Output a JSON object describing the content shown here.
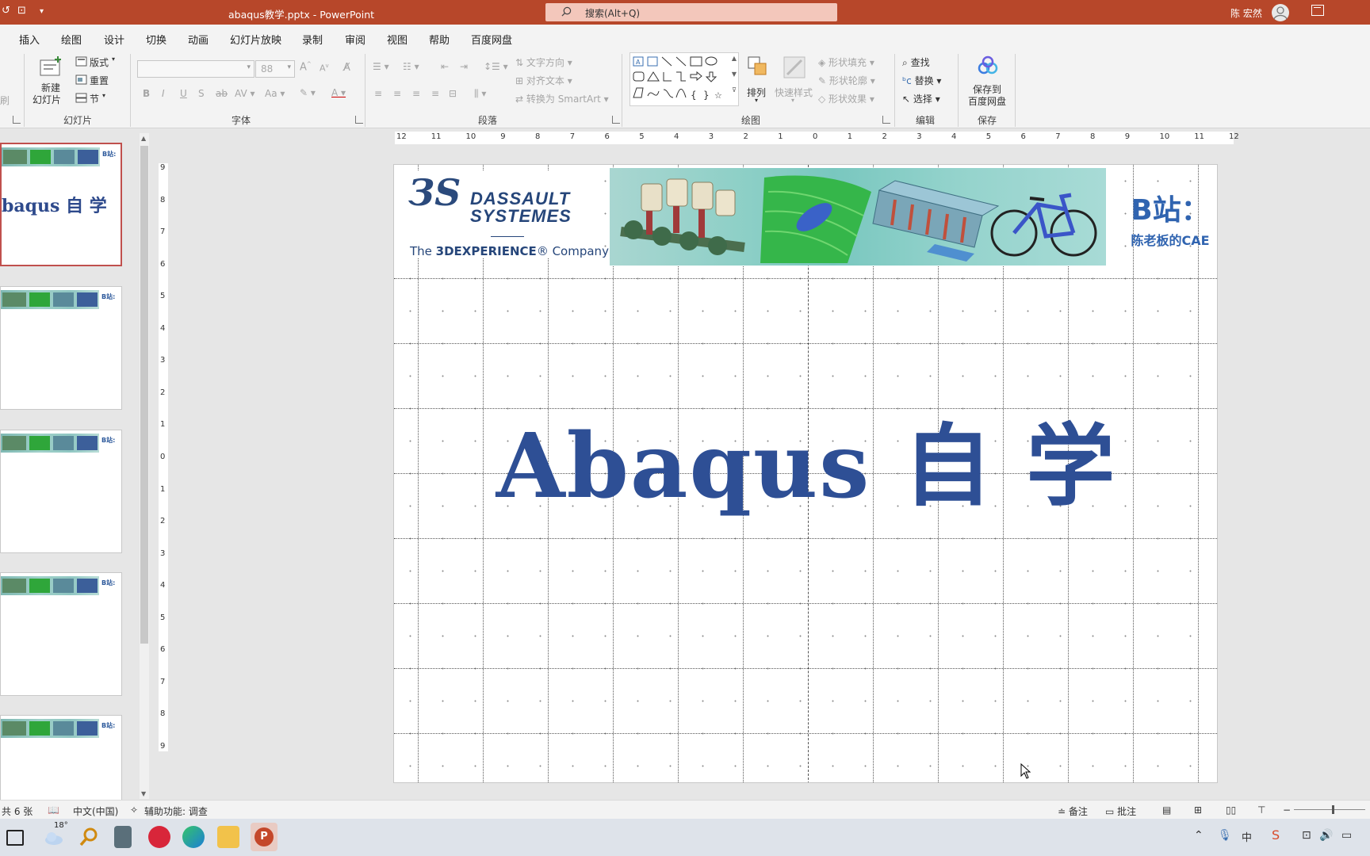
{
  "titlebar": {
    "title": "abaqus教学.pptx  -  PowerPoint",
    "search_placeholder": "搜索(Alt+Q)",
    "user": "陈 宏然"
  },
  "menu": {
    "tabs": [
      "插入",
      "绘图",
      "设计",
      "切换",
      "动画",
      "幻灯片放映",
      "录制",
      "审阅",
      "视图",
      "帮助",
      "百度网盘"
    ]
  },
  "ribbon": {
    "slides": {
      "new_slide": "新建\n幻灯片",
      "new_slide_l1": "新建",
      "new_slide_l2": "幻灯片",
      "layout": "版式",
      "reset": "重置",
      "section": "节",
      "label": "幻灯片"
    },
    "font": {
      "font_name": "",
      "font_size": "88",
      "label": "字体"
    },
    "paragraph": {
      "text_direction": "文字方向",
      "align_text": "对齐文本",
      "convert_smartart": "转换为 SmartArt",
      "label": "段落"
    },
    "drawing": {
      "arrange": "排列",
      "quick_styles": "快速样式",
      "shape_fill": "形状填充",
      "shape_outline": "形状轮廓",
      "shape_effects": "形状效果",
      "label": "绘图"
    },
    "editing": {
      "find": "查找",
      "replace": "替换",
      "select": "选择",
      "label": "编辑"
    },
    "save": {
      "save_baidu_l1": "保存到",
      "save_baidu_l2": "百度网盘",
      "label": "保存"
    },
    "clipboard_fragment": "刷"
  },
  "thumbnails": {
    "selected_title": "baqus 自 学",
    "banner_badge": "B站:"
  },
  "slide": {
    "logo_line1": "DASSAULT",
    "logo_line2": "SYSTEMES",
    "logo_tag_pre": "The ",
    "logo_tag_bold": "3DEXPERIENCE",
    "logo_tag_post": "® Company",
    "bili_line1": "B站：",
    "bili_line2": "陈老板的CAE",
    "title": "Abaqus 自 学"
  },
  "ruler": {
    "h_ticks": [
      "12",
      "11",
      "10",
      "9",
      "8",
      "7",
      "6",
      "5",
      "4",
      "3",
      "2",
      "1",
      "0",
      "1",
      "2",
      "3",
      "4",
      "5",
      "6",
      "7",
      "8",
      "9",
      "10",
      "11",
      "12"
    ],
    "v_ticks": [
      "9",
      "8",
      "7",
      "6",
      "5",
      "4",
      "3",
      "2",
      "1",
      "0",
      "1",
      "2",
      "3",
      "4",
      "5",
      "6",
      "7",
      "8",
      "9"
    ]
  },
  "statusbar": {
    "slide_count": "共 6 张",
    "language": "中文(中国)",
    "accessibility": "辅助功能: 调查",
    "notes": "备注",
    "comments": "批注"
  },
  "taskbar": {
    "weather_temp": "18°"
  },
  "colors": {
    "titlebar": "#b7472a",
    "title_text": "#2e4f95",
    "bilibili": "#3064b0"
  }
}
